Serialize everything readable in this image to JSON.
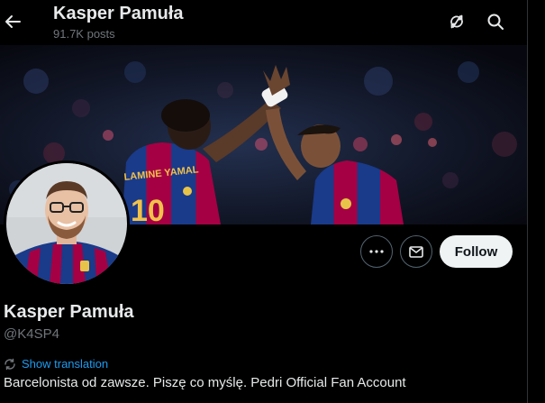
{
  "header": {
    "name": "Kasper Pamuła",
    "posts": "91.7K posts",
    "back_icon": "arrow-left-icon",
    "refresh_icon": "refresh-icon",
    "search_icon": "search-icon"
  },
  "banner": {
    "description_icon": "banner-image",
    "jersey_text": "LAMINE YAMAL",
    "jersey_number": "10"
  },
  "profile": {
    "name": "Kasper Pamuła",
    "handle": "@K4SP4",
    "show_translation": "Show translation",
    "bio": "Barcelonista od zawsze. Piszę co myślę. Pedri Official Fan Account"
  },
  "actions": {
    "more_icon": "more-icon",
    "message_icon": "envelope-icon",
    "follow_label": "Follow"
  },
  "colors": {
    "background": "#000000",
    "text_primary": "#e7e9ea",
    "text_secondary": "#71767b",
    "accent": "#1d9bf0",
    "follow_bg": "#eff3f4",
    "border": "#536471",
    "barca_blue": "#1a3a8a",
    "barca_red": "#a50044"
  }
}
